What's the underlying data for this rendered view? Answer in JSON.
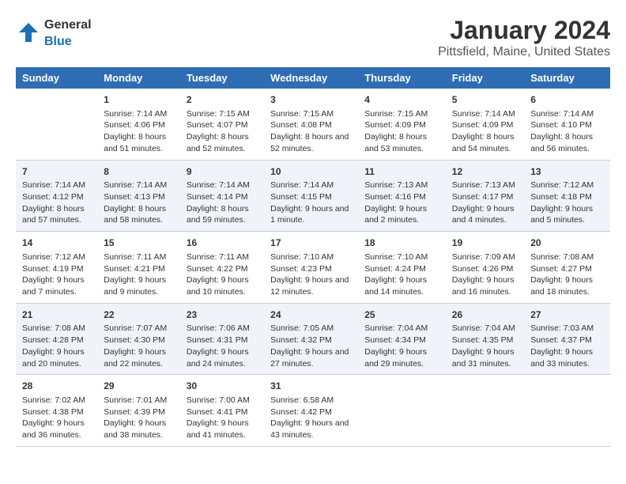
{
  "header": {
    "logo_general": "General",
    "logo_blue": "Blue",
    "title": "January 2024",
    "subtitle": "Pittsfield, Maine, United States"
  },
  "calendar": {
    "days_of_week": [
      "Sunday",
      "Monday",
      "Tuesday",
      "Wednesday",
      "Thursday",
      "Friday",
      "Saturday"
    ],
    "weeks": [
      [
        {
          "day": "",
          "sunrise": "",
          "sunset": "",
          "daylight": ""
        },
        {
          "day": "1",
          "sunrise": "Sunrise: 7:14 AM",
          "sunset": "Sunset: 4:06 PM",
          "daylight": "Daylight: 8 hours and 51 minutes."
        },
        {
          "day": "2",
          "sunrise": "Sunrise: 7:15 AM",
          "sunset": "Sunset: 4:07 PM",
          "daylight": "Daylight: 8 hours and 52 minutes."
        },
        {
          "day": "3",
          "sunrise": "Sunrise: 7:15 AM",
          "sunset": "Sunset: 4:08 PM",
          "daylight": "Daylight: 8 hours and 52 minutes."
        },
        {
          "day": "4",
          "sunrise": "Sunrise: 7:15 AM",
          "sunset": "Sunset: 4:09 PM",
          "daylight": "Daylight: 8 hours and 53 minutes."
        },
        {
          "day": "5",
          "sunrise": "Sunrise: 7:14 AM",
          "sunset": "Sunset: 4:09 PM",
          "daylight": "Daylight: 8 hours and 54 minutes."
        },
        {
          "day": "6",
          "sunrise": "Sunrise: 7:14 AM",
          "sunset": "Sunset: 4:10 PM",
          "daylight": "Daylight: 8 hours and 56 minutes."
        }
      ],
      [
        {
          "day": "7",
          "sunrise": "Sunrise: 7:14 AM",
          "sunset": "Sunset: 4:12 PM",
          "daylight": "Daylight: 8 hours and 57 minutes."
        },
        {
          "day": "8",
          "sunrise": "Sunrise: 7:14 AM",
          "sunset": "Sunset: 4:13 PM",
          "daylight": "Daylight: 8 hours and 58 minutes."
        },
        {
          "day": "9",
          "sunrise": "Sunrise: 7:14 AM",
          "sunset": "Sunset: 4:14 PM",
          "daylight": "Daylight: 8 hours and 59 minutes."
        },
        {
          "day": "10",
          "sunrise": "Sunrise: 7:14 AM",
          "sunset": "Sunset: 4:15 PM",
          "daylight": "Daylight: 9 hours and 1 minute."
        },
        {
          "day": "11",
          "sunrise": "Sunrise: 7:13 AM",
          "sunset": "Sunset: 4:16 PM",
          "daylight": "Daylight: 9 hours and 2 minutes."
        },
        {
          "day": "12",
          "sunrise": "Sunrise: 7:13 AM",
          "sunset": "Sunset: 4:17 PM",
          "daylight": "Daylight: 9 hours and 4 minutes."
        },
        {
          "day": "13",
          "sunrise": "Sunrise: 7:12 AM",
          "sunset": "Sunset: 4:18 PM",
          "daylight": "Daylight: 9 hours and 5 minutes."
        }
      ],
      [
        {
          "day": "14",
          "sunrise": "Sunrise: 7:12 AM",
          "sunset": "Sunset: 4:19 PM",
          "daylight": "Daylight: 9 hours and 7 minutes."
        },
        {
          "day": "15",
          "sunrise": "Sunrise: 7:11 AM",
          "sunset": "Sunset: 4:21 PM",
          "daylight": "Daylight: 9 hours and 9 minutes."
        },
        {
          "day": "16",
          "sunrise": "Sunrise: 7:11 AM",
          "sunset": "Sunset: 4:22 PM",
          "daylight": "Daylight: 9 hours and 10 minutes."
        },
        {
          "day": "17",
          "sunrise": "Sunrise: 7:10 AM",
          "sunset": "Sunset: 4:23 PM",
          "daylight": "Daylight: 9 hours and 12 minutes."
        },
        {
          "day": "18",
          "sunrise": "Sunrise: 7:10 AM",
          "sunset": "Sunset: 4:24 PM",
          "daylight": "Daylight: 9 hours and 14 minutes."
        },
        {
          "day": "19",
          "sunrise": "Sunrise: 7:09 AM",
          "sunset": "Sunset: 4:26 PM",
          "daylight": "Daylight: 9 hours and 16 minutes."
        },
        {
          "day": "20",
          "sunrise": "Sunrise: 7:08 AM",
          "sunset": "Sunset: 4:27 PM",
          "daylight": "Daylight: 9 hours and 18 minutes."
        }
      ],
      [
        {
          "day": "21",
          "sunrise": "Sunrise: 7:08 AM",
          "sunset": "Sunset: 4:28 PM",
          "daylight": "Daylight: 9 hours and 20 minutes."
        },
        {
          "day": "22",
          "sunrise": "Sunrise: 7:07 AM",
          "sunset": "Sunset: 4:30 PM",
          "daylight": "Daylight: 9 hours and 22 minutes."
        },
        {
          "day": "23",
          "sunrise": "Sunrise: 7:06 AM",
          "sunset": "Sunset: 4:31 PM",
          "daylight": "Daylight: 9 hours and 24 minutes."
        },
        {
          "day": "24",
          "sunrise": "Sunrise: 7:05 AM",
          "sunset": "Sunset: 4:32 PM",
          "daylight": "Daylight: 9 hours and 27 minutes."
        },
        {
          "day": "25",
          "sunrise": "Sunrise: 7:04 AM",
          "sunset": "Sunset: 4:34 PM",
          "daylight": "Daylight: 9 hours and 29 minutes."
        },
        {
          "day": "26",
          "sunrise": "Sunrise: 7:04 AM",
          "sunset": "Sunset: 4:35 PM",
          "daylight": "Daylight: 9 hours and 31 minutes."
        },
        {
          "day": "27",
          "sunrise": "Sunrise: 7:03 AM",
          "sunset": "Sunset: 4:37 PM",
          "daylight": "Daylight: 9 hours and 33 minutes."
        }
      ],
      [
        {
          "day": "28",
          "sunrise": "Sunrise: 7:02 AM",
          "sunset": "Sunset: 4:38 PM",
          "daylight": "Daylight: 9 hours and 36 minutes."
        },
        {
          "day": "29",
          "sunrise": "Sunrise: 7:01 AM",
          "sunset": "Sunset: 4:39 PM",
          "daylight": "Daylight: 9 hours and 38 minutes."
        },
        {
          "day": "30",
          "sunrise": "Sunrise: 7:00 AM",
          "sunset": "Sunset: 4:41 PM",
          "daylight": "Daylight: 9 hours and 41 minutes."
        },
        {
          "day": "31",
          "sunrise": "Sunrise: 6:58 AM",
          "sunset": "Sunset: 4:42 PM",
          "daylight": "Daylight: 9 hours and 43 minutes."
        },
        {
          "day": "",
          "sunrise": "",
          "sunset": "",
          "daylight": ""
        },
        {
          "day": "",
          "sunrise": "",
          "sunset": "",
          "daylight": ""
        },
        {
          "day": "",
          "sunrise": "",
          "sunset": "",
          "daylight": ""
        }
      ]
    ]
  }
}
